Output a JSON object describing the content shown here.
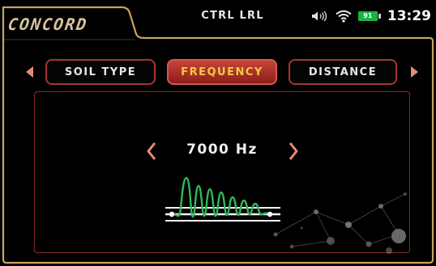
{
  "header": {
    "brand": "CONCORD",
    "device_title": "CTRL LRL"
  },
  "status_bar": {
    "icons": [
      "speaker-icon",
      "wifi-icon",
      "battery-icon"
    ],
    "battery_level": "91",
    "time": "13:29"
  },
  "tabs": [
    {
      "label": "SOIL TYPE",
      "active": false
    },
    {
      "label": "FREQUENCY",
      "active": true
    },
    {
      "label": "DISTANCE",
      "active": false
    }
  ],
  "frequency_panel": {
    "value": "7000 Hz",
    "icons": [
      "chevron-left-icon",
      "chevron-right-icon",
      "frequency-wave-icon"
    ]
  },
  "colors": {
    "frame_gold": "#c9a45a",
    "accent_red": "#a83434",
    "active_tab_top": "#c7433a",
    "active_tab_text": "#f6c93e",
    "arrow_salmon": "#e08f75",
    "wave_green": "#2fb85a",
    "battery_green": "#19b34a"
  }
}
